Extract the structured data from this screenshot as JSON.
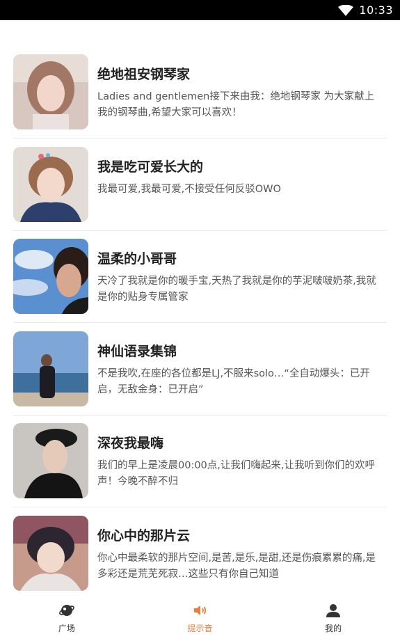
{
  "status_bar": {
    "time": "10:33"
  },
  "list": [
    {
      "title": "绝地祖安钢琴家",
      "desc": "Ladies and gentlemen接下来由我：绝地钢琴家 为大家献上我的钢琴曲,希望大家可以喜欢！"
    },
    {
      "title": "我是吃可爱长大的",
      "desc": "我最可爱,我最可爱,不接受任何反驳OWO"
    },
    {
      "title": "温柔的小哥哥",
      "desc": "天冷了我就是你的暖手宝,天热了我就是你的芋泥啵啵奶茶,我就是你的贴身专属管家"
    },
    {
      "title": "神仙语录集锦",
      "desc": "不是我吹,在座的各位都是LJ,不服来solo…“全自动爆头：已开启，无敌金身：已开启”"
    },
    {
      "title": "深夜我最嗨",
      "desc": "我们的早上是凌晨00:00点,让我们嗨起来,让我听到你们的欢呼声！今晚不醉不归"
    },
    {
      "title": "你心中的那片云",
      "desc": "你心中最柔软的那片空间,是苦,是乐,是甜,还是伤痕累累的痛,是多彩还是荒芜死寂…这些只有你自己知道"
    }
  ],
  "tabbar": {
    "tabs": [
      {
        "label": "广场",
        "icon": "planet-icon"
      },
      {
        "label": "提示音",
        "icon": "speaker-icon"
      },
      {
        "label": "我的",
        "icon": "user-icon"
      }
    ],
    "active_color": "#f07a3a"
  }
}
